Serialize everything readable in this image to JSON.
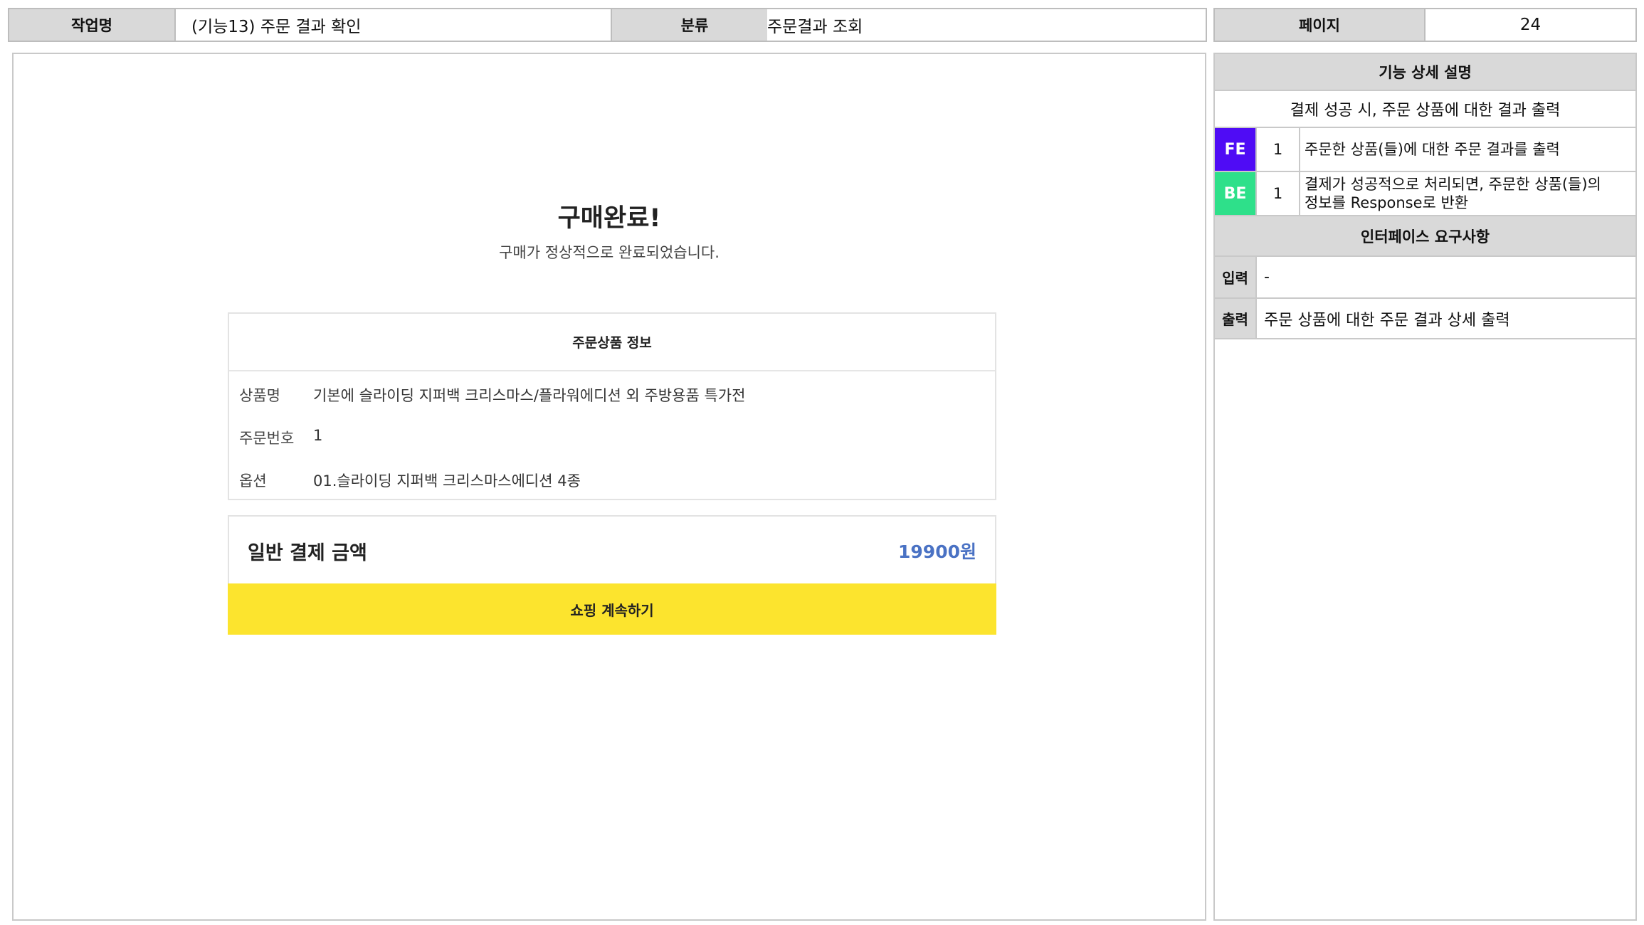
{
  "header": {
    "task_label": "작업명",
    "task_value": "(기능13) 주문 결과 확인",
    "category_label": "분류",
    "category_value": "주문결과 조회",
    "page_label": "페이지",
    "page_value": "24"
  },
  "screen": {
    "title": "구매완료!",
    "subtitle": "구매가 정상적으로 완료되었습니다.",
    "order_box": {
      "title": "주문상품 정보",
      "rows": [
        {
          "label": "상품명",
          "value": "기본에 슬라이딩 지퍼백 크리스마스/플라워에디션 외 주방용품 특가전"
        },
        {
          "label": "주문번호",
          "value": "1"
        },
        {
          "label": "옵션",
          "value": "01.슬라이딩 지퍼백 크리스마스에디션 4종"
        }
      ]
    },
    "payment": {
      "label": "일반 결제 금액",
      "amount": "19900원",
      "amount_color": "#4a72c4"
    },
    "continue_button": "쇼핑 계속하기",
    "continue_button_color": "#fce42e"
  },
  "spec": {
    "detail_title": "기능 상세 설명",
    "detail_summary": "결제 성공 시, 주문 상품에 대한 결과 출력",
    "items": [
      {
        "tag": "FE",
        "tag_color": "#4f0cf5",
        "num": "1",
        "desc": "주문한 상품(들)에 대한 주문 결과를 출력"
      },
      {
        "tag": "BE",
        "tag_color": "#2ee08a",
        "num": "1",
        "desc_line1": "결제가 성공적으로 처리되면, 주문한 상품(들)의",
        "desc_line2": "정보를 Response로 반환"
      }
    ],
    "interface_title": "인터페이스 요구사항",
    "input_label": "입력",
    "input_value": "-",
    "output_label": "출력",
    "output_value": "주문 상품에 대한 주문 결과 상세 출력"
  }
}
